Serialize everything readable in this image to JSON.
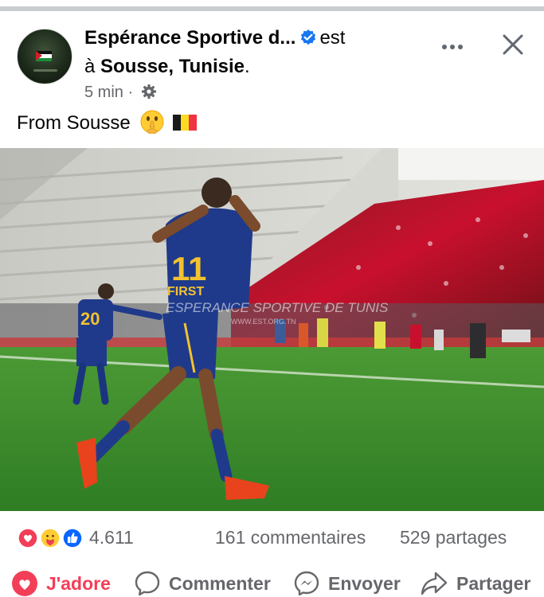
{
  "post": {
    "page_name": "Espérance Sportive d...",
    "location_prefix": "est",
    "location_at": "à",
    "location": "Sousse, Tunisie",
    "location_suffix": ".",
    "time": "5 min",
    "meta_separator": "·",
    "caption": "From Sousse"
  },
  "photo": {
    "watermark": "ESPERANCE SPORTIVE DE TUNIS",
    "watermark_url": "WWW.EST.ORG.TN",
    "jersey_number_main": "11",
    "jersey_sponsor": "FIRST",
    "jersey_number_second": "20"
  },
  "stats": {
    "reaction_count": "4.611",
    "comments": "161 commentaires",
    "shares": "529 partages"
  },
  "actions": {
    "love": "J'adore",
    "comment": "Commenter",
    "send": "Envoyer",
    "share": "Partager"
  },
  "colors": {
    "love_accent": "#f33e58",
    "like_blue": "#0866ff",
    "verified_blue": "#1877f2",
    "jersey_navy": "#1f3a8a",
    "jersey_yellow": "#f2c230",
    "crowd_red": "#c8102e",
    "pitch_green": "#3f8f2e"
  },
  "icons": {
    "verified": "verified-badge-icon",
    "privacy": "gear-icon",
    "more": "more-horizontal-icon",
    "close": "close-icon",
    "love": "heart-icon",
    "comment": "comment-bubble-icon",
    "send": "messenger-icon",
    "share": "share-arrow-icon"
  }
}
